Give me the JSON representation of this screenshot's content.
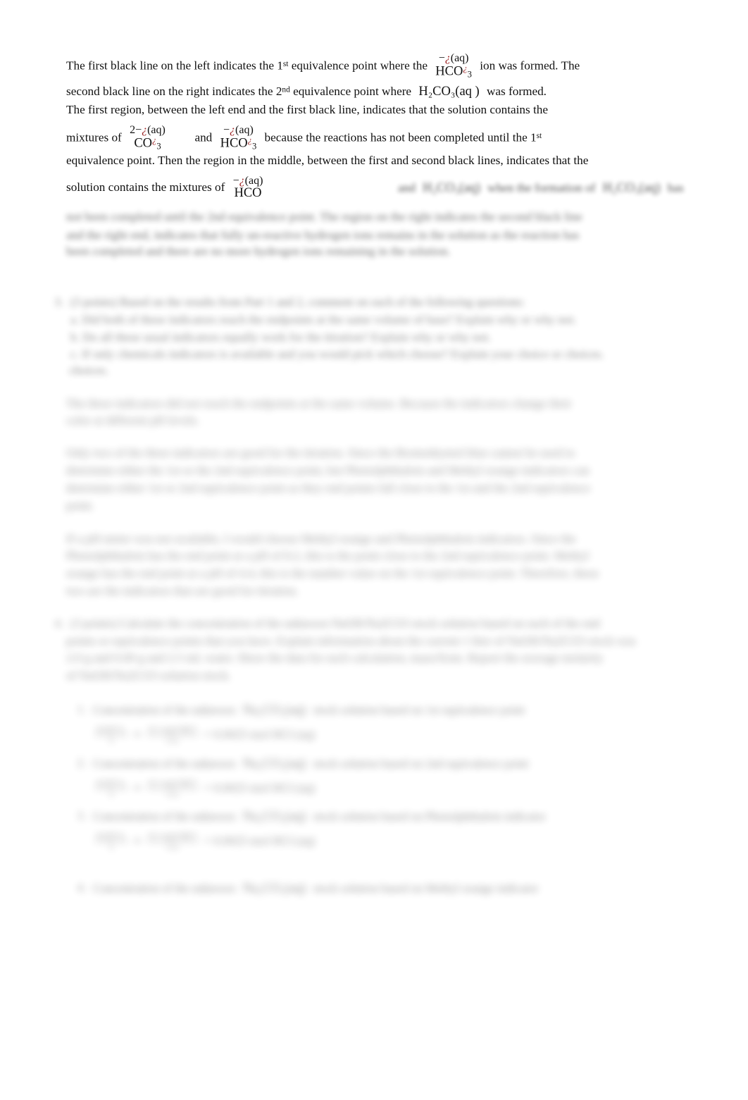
{
  "document": {
    "type": "chemistry-lab-report",
    "topic": "Acid-base titration equivalence points and indicators",
    "page_background": "#ffffff",
    "text_color": "#111111",
    "broken_equation_marker_color": "#9b2020"
  },
  "paragraph1": {
    "s1": "The first black line on the left indicates the 1",
    "s1_sup": "st",
    "s2": " equivalence point where the",
    "formula1": {
      "upper_sign": "−",
      "upper_brk": "¿",
      "upper_state": "(aq)",
      "lower_base": "HCO",
      "lower_brk": "¿",
      "lower_sub": "3"
    },
    "s3": "ion was formed. The",
    "s4": "second black line on the right indicates the 2",
    "s4_sup": "nd",
    "s5": " equivalence point where",
    "formula2": "H₂CO₃(aq )",
    "s6": "was formed.",
    "s7": "The first region, between the left end and the first black line, indicates that the solution contains the",
    "s8": "mixtures of",
    "formula3": {
      "upper_charge": "2−",
      "upper_brk": "¿",
      "upper_state": "(aq)",
      "lower_base": "CO",
      "lower_brk": "¿",
      "lower_sub": "3"
    },
    "s9": "and",
    "formula4": {
      "upper_sign": "−",
      "upper_brk": "¿",
      "upper_state": "(aq)",
      "lower_base": "HCO",
      "lower_brk": "¿",
      "lower_sub": "3"
    },
    "s10": "because the reactions has not been completed until the 1",
    "s10_sup": "st",
    "s11": "equivalence point. Then the region in the middle, between the first and second black lines, indicates that the",
    "s12": "solution contains the mixtures of",
    "formula5": {
      "upper_sign": "−",
      "upper_brk": "¿",
      "upper_state": "(aq)",
      "lower_base": "HCO"
    },
    "s13_blurred": "and",
    "formula6_blurred": "H₂CO₃(aq)",
    "s14_blurred": "when the formation of",
    "formula7_blurred": "H₂CO₃(aq)",
    "s15_blurred": "has"
  },
  "paragraph1_tail_blurred": {
    "line1": "not been completed until the 2nd equivalence point. The region on the right indicates the second black line",
    "line2": "and the right end, indicates that fully un-reactive hydrogen ions remains in the solution as the reaction has",
    "line3": "been completed and there are no more hydrogen ions remaining in the solution."
  },
  "question3_blurred": {
    "marker": "3.",
    "intro": "(3 points) Based on the results from Part 1 and 2, comment on each of the following questions:",
    "bullets": [
      "a.  Did both of these indicators reach the endpoints at the same volume of base? Explain why or why not.",
      "b.  Do all these usual indicators equally work for the titration? Explain why or why not.",
      "c.  If only chemicals indicators is available and you would pick which choose? Explain your choice or choices."
    ]
  },
  "answer3a_blurred": {
    "line1": "The three indicators did not reach the endpoints at the same volume. Because the indicators change their",
    "line2": "color at different pH levels."
  },
  "answer3b_blurred": {
    "line1": "Only two of the three indicators are good for the titration. Since the Bromothymol blue cannot be used to",
    "line2": "determine either the 1st or the 2nd equivalence point, but Phenolphthalein and Methyl orange indicators can",
    "line3": "determine either 1st or 2nd equivalence point as they end points fall close to the 1st and the 2nd equivalence",
    "line4": "point."
  },
  "answer3c_blurred": {
    "line1": "If a pH meter was not available, I would choose Methyl orange and Phenolphthalein indicators. Since the",
    "line2": "Phenolphthalein has the end point at a pH of 8.2, this is the point close to the 2nd equivalence point. Methyl",
    "line3": "orange has the end point at a pH of 4.4, this is the number value on the 1st equivalence point. Therefore, these",
    "line4": "two are the indicators that are good for titration."
  },
  "question4_blurred": {
    "marker": "4.",
    "line1": "(3 points) Calculate the concentration of the unknown NaOH/Na2CO3 stock solution based on each of the end",
    "line2": "points or equivalence points that you have. Explain information about the current 1 liter of NaOH/Na2CO3 stock was",
    "line3": "2.0 g and 0.00 g and 2.5 mL water. Show the data for each calculation, mass/from. Report the average molarity",
    "line4": "of NaOH/Na2CO3 solution stock."
  },
  "subitems_blurred": [
    {
      "marker": "1.",
      "text_a": "Concentration of the unknown",
      "formula": "Na₂CO₃(aq)",
      "text_b": "stock solution based on 1st equivalence point",
      "eq_left_num": "0.025 L",
      "eq_left_den": "1",
      "eq_mid": "×",
      "eq_right_num": "0.1 mol HCl",
      "eq_right_den": "1 L",
      "eq_result": "= 0.0025 mol HCl (aq)"
    },
    {
      "marker": "2.",
      "text_a": "Concentration of the unknown",
      "formula": "Na₂CO₃(aq)",
      "text_b": "stock solution based on 2nd equivalence point",
      "eq_left_num": "0.025 L",
      "eq_left_den": "1",
      "eq_mid": "×",
      "eq_right_num": "0.1 mol HCl",
      "eq_right_den": "1 L",
      "eq_result": "= 0.0025 mol HCl (aq)"
    },
    {
      "marker": "3.",
      "text_a": "Concentration of the unknown",
      "formula": "Na₂CO₃(aq)",
      "text_b": "stock solution based on Phenolphthalein indicator",
      "eq_left_num": "0.025 L",
      "eq_left_den": "1",
      "eq_mid": "×",
      "eq_right_num": "0.1 mol HCl",
      "eq_right_den": "1 L",
      "eq_result": "= 0.0025 mol HCl (aq)"
    },
    {
      "marker": "4.",
      "text_a": "Concentration of the unknown",
      "formula": "Na₂CO₃(aq)",
      "text_b": "stock solution based on Methyl orange indicator",
      "eq_left_num": "",
      "eq_left_den": "",
      "eq_mid": "",
      "eq_right_num": "",
      "eq_right_den": "",
      "eq_result": ""
    }
  ]
}
